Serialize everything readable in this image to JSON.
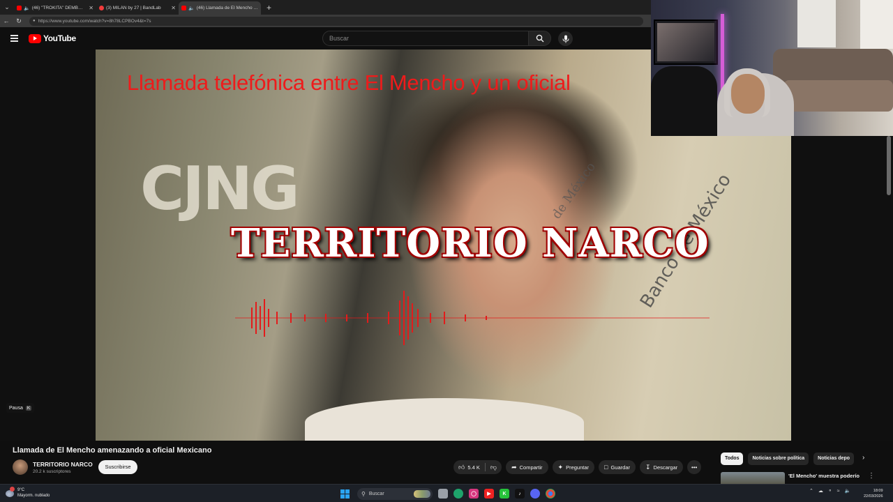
{
  "browser": {
    "tabs": [
      {
        "title": "(46) \"TROKITA\" DEMBOW BE...",
        "favicon_color": "#ff0000",
        "audio": true,
        "active": false
      },
      {
        "title": "(3) MILÁN by 27 | BandLab",
        "favicon_color": "#f23b3b",
        "audio": false,
        "active": false
      },
      {
        "title": "(46) Llamada de El Mencho a...",
        "favicon_color": "#ff0000",
        "audio": true,
        "active": true
      }
    ],
    "url": "https://www.youtube.com/watch?v=8h78LCPBOv4&t=7s"
  },
  "youtube": {
    "logo_text": "YouTube",
    "search_placeholder": "Buscar",
    "icons": {
      "menu": "hamburger-icon",
      "search": "search-icon",
      "mic": "mic-icon"
    }
  },
  "video": {
    "overlay_red_title": "Llamada telefónica entre El Mencho y un oficial",
    "overlay_big_title": "TERRITORIO NARCO",
    "overlay_cjng": "CJNG",
    "overlay_bank": "Banco de México",
    "overlay_bank_small": "de México",
    "pause_label": "Pausa",
    "pause_key": "K"
  },
  "info": {
    "title": "Llamada de El Mencho amenazando a oficial Mexicano",
    "channel_name": "TERRITORIO NARCO",
    "subscribers": "20.2 k suscriptores",
    "subscribe_label": "Suscribirse",
    "likes": "5.4 K",
    "share_label": "Compartir",
    "ask_label": "Preguntar",
    "save_label": "Guardar",
    "download_label": "Descargar"
  },
  "chips": [
    "Todos",
    "Noticias sobre política",
    "Noticias depo"
  ],
  "recommendation": {
    "title": "'El Mencho' muestra poderío"
  },
  "taskbar": {
    "weather_temp": "9°C",
    "weather_desc": "Mayorm. nublado",
    "search_label": "Buscar",
    "time": "18:09",
    "date": "22/03/2026",
    "accent": "#2aa4f4"
  }
}
